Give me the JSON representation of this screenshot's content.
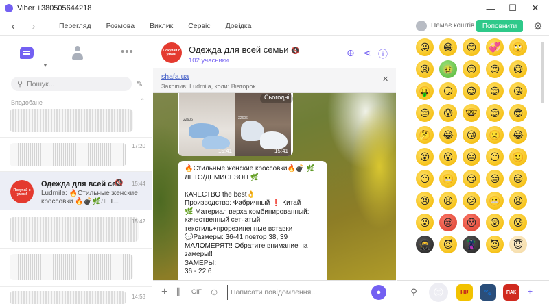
{
  "window": {
    "title": "Viber +380505644218",
    "controls": {
      "minimize": "—",
      "maximize": "☐",
      "close": "✕"
    }
  },
  "menu": {
    "back": "‹",
    "forward": "›",
    "items": [
      "Перегляд",
      "Розмова",
      "Виклик",
      "Сервіс",
      "Довідка"
    ],
    "credits": "Немає коштів",
    "topup_label": "Поповнити",
    "accent": "#7360f2",
    "topup_color": "#2ec98a"
  },
  "sidebar": {
    "search_placeholder": "Пошук...",
    "section_label": "Вподобане",
    "chats": [
      {
        "time": "17:20"
      },
      {
        "time": "15:42"
      },
      {
        "time": "14:53"
      }
    ],
    "active": {
      "avatar_text": "Покупай с умом!",
      "name": "Одежда для всей се...",
      "time": "15:44",
      "preview_line1": "Ludmila: 🔥Стильные женские",
      "preview_line2": "кроссовки 🔥💣🌿ЛЕТ..."
    }
  },
  "chat": {
    "title": "Одежда для всей семьи",
    "mute_icon": "🔇",
    "members": "102 учасники",
    "avatar_text": "Покупай с умом!",
    "pinned_link": "shafa.ua",
    "pinned_info": "Закріпив: Ludmila, коли: Вівторок",
    "pinned_close": "✕",
    "today_label": "Сьогодні",
    "photo_times": [
      "15:41",
      "15:41"
    ],
    "photo_tags": [
      "22606",
      "22606"
    ],
    "message_lines": [
      "🔥Стильные женские кроссовки🔥💣 🌿",
      "ЛЕТО/ДЕМИСЕЗОН 🌿",
      "",
      "КАЧЕСТВО the best👌",
      "Производство: Фабричный ❗ Китай",
      "🌿 Материал верха комбинированный:",
      "качественный сетчатый",
      "текстиль+прорезиненные вставки",
      "💬Размеры: 36-41 повтор 38, 39",
      "МАЛОМЕРЯТ!! Обратите внимание на",
      "замеры!!",
      "ЗАМЕРЫ:",
      "36 - 22,6"
    ],
    "input_placeholder": "Написати повідомлення..."
  },
  "emoji_panel": {
    "emojis": [
      "😜",
      "😁",
      "😊",
      "💞",
      "🙄",
      "😫",
      "🤢",
      "😌",
      "😍",
      "😋",
      "🤑",
      "😏",
      "😉",
      "😌",
      "😘",
      "😔",
      "😰",
      "🤓",
      "😌",
      "😎",
      "🤔",
      "😂",
      "😘",
      "🙁",
      "😂",
      "😵",
      "😵",
      "😐",
      "😶",
      "🙂",
      "😶",
      "😬",
      "😏",
      "😑",
      "😑",
      "😠",
      "😣",
      "😕",
      "😬",
      "😡",
      "😮",
      "😒",
      "😯",
      "😲",
      "😰",
      "🥷",
      "😈",
      "🦹",
      "😈",
      "😇"
    ],
    "tabs": [
      "😊",
      "HI!",
      "🐾",
      "ПАК",
      "+"
    ]
  }
}
